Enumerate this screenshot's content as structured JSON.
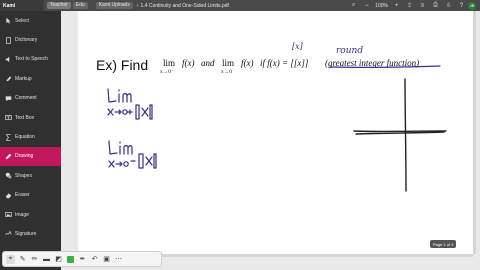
{
  "topbar": {
    "app": "Kami",
    "tab_teacher": "Teacher",
    "tab_edu": "Edu",
    "tab_uploads": "Kami Uploads",
    "filename": "1.4 Continuity and One-Sided Limits.pdf",
    "zoom": "100%",
    "avatar": "JB"
  },
  "sidebar": {
    "items": [
      {
        "label": "Select",
        "icon": "cursor-icon"
      },
      {
        "label": "Dictionary",
        "icon": "book-icon"
      },
      {
        "label": "Text to Speech",
        "icon": "speaker-icon"
      },
      {
        "label": "Markup",
        "icon": "highlighter-icon"
      },
      {
        "label": "Comment",
        "icon": "comment-icon"
      },
      {
        "label": "Text Box",
        "icon": "textbox-icon"
      },
      {
        "label": "Equation",
        "icon": "equation-icon"
      },
      {
        "label": "Drawing",
        "icon": "pen-icon"
      },
      {
        "label": "Shapes",
        "icon": "shapes-icon"
      },
      {
        "label": "Eraser",
        "icon": "eraser-icon"
      },
      {
        "label": "Image",
        "icon": "image-icon"
      },
      {
        "label": "Signature",
        "icon": "signature-icon"
      }
    ],
    "active_index": 7,
    "active_color": "#c2185b"
  },
  "document": {
    "heading": "Ex) Find",
    "lim_word": "lim",
    "sub_left": "x→0⁻",
    "sub_right": "x→0",
    "fx": "f(x)",
    "and_word": "and",
    "if_clause": "if f(x) = [[x]]",
    "paren_text": "(greatest integer function)",
    "annot_round": "round",
    "annot_bracket": "[x]"
  },
  "page_tag": "Page 1 of 1",
  "bottom_toolbar": {
    "tools": [
      "select-tool-icon",
      "pen-icon",
      "pencil-icon",
      "marker-icon",
      "eraser-icon",
      "color-swatch",
      "ink-icon",
      "undo-icon",
      "stamp-icon",
      "more-icon"
    ],
    "swatch_color": "#3cb043"
  },
  "colors": {
    "ink": "#3b2a8c",
    "sidebar_bg": "#303030",
    "topbar_bg": "#4a4a4a"
  }
}
